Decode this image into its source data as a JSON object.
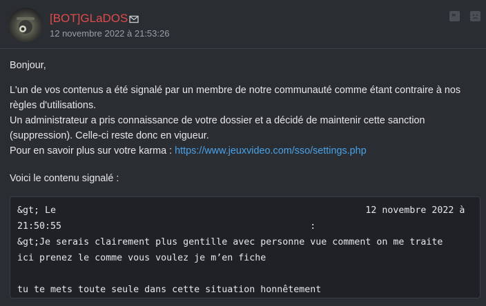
{
  "post": {
    "author": "[BOT]GLaDOS",
    "date": "12 novembre 2022 à 21:53:26",
    "icons": {
      "mail": "mail-icon",
      "quote": "quote-icon",
      "report": "report-icon"
    },
    "colors": {
      "author": "#e04b4b",
      "link": "#4aa3e8",
      "background": "#2a2d32"
    }
  },
  "message": {
    "greeting": "Bonjour,",
    "line1": "L'un de vos contenus a été signalé par un membre de notre communauté comme étant contraire à nos",
    "line2": "règles d'utilisations.",
    "line3": "Un administrateur a pris connaissance de votre dossier et a décidé de maintenir cette sanction",
    "line4": "(suppression). Celle-ci reste donc en vigueur.",
    "line5_prefix": "Pour en savoir plus sur votre karma : ",
    "link": "https://www.jeuxvideo.com/sso/settings.php",
    "reported_intro": "Voici le contenu signalé :",
    "code_line1": "&gt; Le                                                        12 novembre 2022 à",
    "code_line2": "21:50:55                                             :",
    "code_line3": "&gt;Je serais clairement plus gentille avec personne vue comment on me traite",
    "code_line4": "ici prenez le comme vous voulez je m’en fiche",
    "code_line5": "",
    "code_line6": "tu te mets toute seule dans cette situation honnêtement"
  }
}
